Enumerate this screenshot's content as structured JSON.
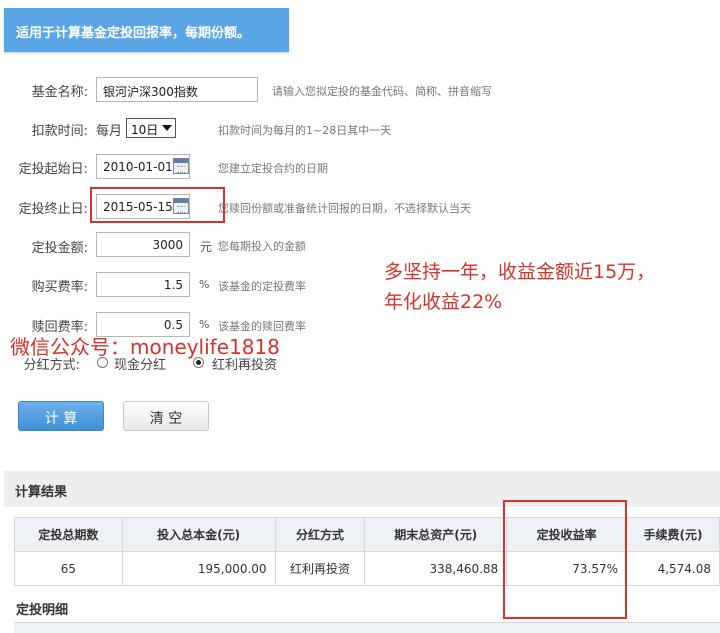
{
  "banner": "适用于计算基金定投回报率，每期份额。",
  "form": {
    "fund_name": {
      "label": "基金名称:",
      "value": "银河沪深300指数",
      "hint": "请输入您拟定投的基金代码、简称、拼音缩写"
    },
    "deduct": {
      "label": "扣款时间:",
      "prefix": "每月",
      "selected": "10日",
      "hint": "扣款时间为每月的1~28日其中一天"
    },
    "start_date": {
      "label": "定投起始日:",
      "value": "2010-01-01",
      "hint": "您建立定投合约的日期"
    },
    "end_date": {
      "label": "定投终止日:",
      "value": "2015-05-15",
      "hint": "您赎回份额或准备统计回报的日期，不选择默认当天"
    },
    "amount": {
      "label": "定投金额:",
      "value": "3000",
      "unit": "元",
      "hint": "您每期投入的金额"
    },
    "buy_fee": {
      "label": "购买费率:",
      "value": "1.5",
      "unit": "%",
      "hint": "该基金的定投费率"
    },
    "redeem_fee": {
      "label": "赎回费率:",
      "value": "0.5",
      "unit": "%",
      "hint": "该基金的赎回费率"
    },
    "dividend": {
      "label": "分红方式:",
      "option1": "现金分红",
      "option2": "红利再投资",
      "selected": "红利再投资"
    }
  },
  "annotation": {
    "line1": "多坚持一年，收益金额近15万，",
    "line2": "年化收益22%",
    "wechat": "微信公众号：moneylife1818"
  },
  "buttons": {
    "calculate": "计 算",
    "clear": "清 空"
  },
  "results": {
    "title": "计算结果",
    "headers": [
      "定投总期数",
      "投入总本金(元)",
      "分红方式",
      "期末总资产(元)",
      "定投收益率",
      "手续费(元)"
    ],
    "row": [
      "65",
      "195,000.00",
      "红利再投资",
      "338,460.88",
      "73.57%",
      "4,574.08"
    ]
  },
  "detail": {
    "title": "定投明细"
  },
  "colors": {
    "accent": "#5aa6e4",
    "highlight_red": "#d4332b"
  }
}
